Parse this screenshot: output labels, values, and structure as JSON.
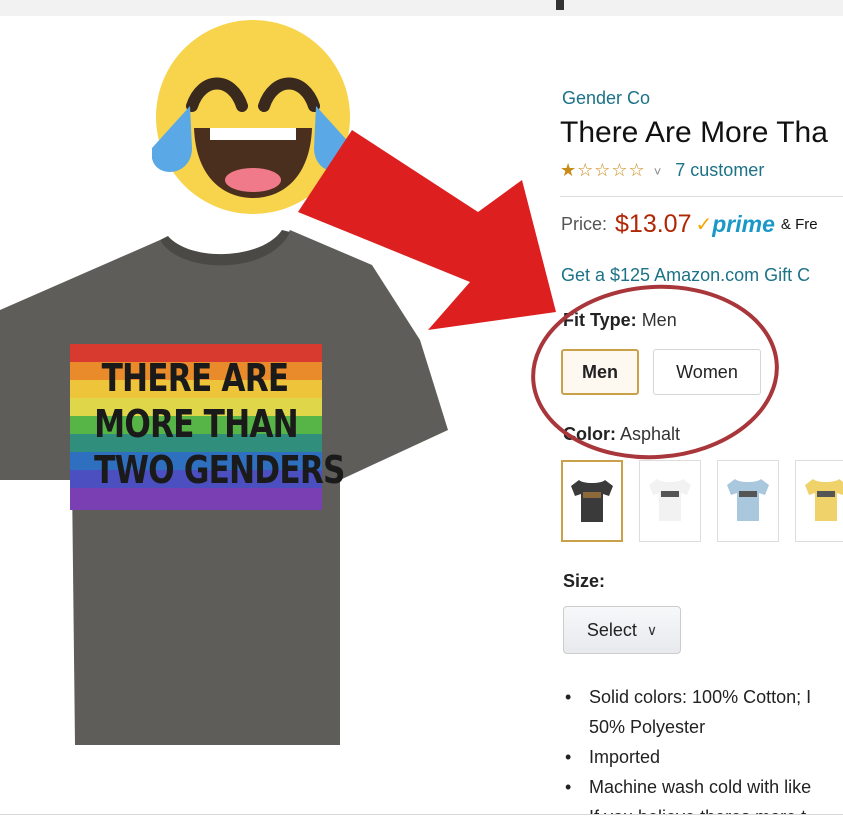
{
  "shirt": {
    "lines": [
      "THERE ARE",
      "MORE THAN",
      "TWO GENDERS"
    ]
  },
  "emoji": {
    "icon": "face-with-tears-of-joy-icon"
  },
  "product": {
    "brand": "Gender Co",
    "title": "There Are More Tha",
    "rating": {
      "stars": "★☆☆☆☆",
      "caret": "˅",
      "reviews": "7 customer"
    },
    "price": {
      "label": "Price:",
      "value": "$13.07",
      "check": "✓",
      "prime": "prime",
      "free": "& Fre"
    },
    "gift": "Get a $125 Amazon.com Gift C",
    "fit": {
      "label": "Fit Type:",
      "value": "Men",
      "options": [
        "Men",
        "Women"
      ]
    },
    "color": {
      "label": "Color:",
      "value": "Asphalt"
    },
    "swatch_colors": [
      "#3a3a3a",
      "#f2f2f2",
      "#a9c7dd",
      "#efd36a"
    ],
    "size": {
      "label": "Size:",
      "select_label": "Select",
      "chevron": "∨"
    },
    "bullets": [
      "Solid colors: 100% Cotton; I",
      "50% Polyester",
      "Imported",
      "Machine wash cold with like",
      "If you believe theres more t"
    ]
  },
  "colors": {
    "arrow": "#dd1f1f",
    "ellipse": "#a8363a",
    "shirt": "#5e5d5a",
    "link": "#1c7287",
    "price": "#b12704"
  }
}
